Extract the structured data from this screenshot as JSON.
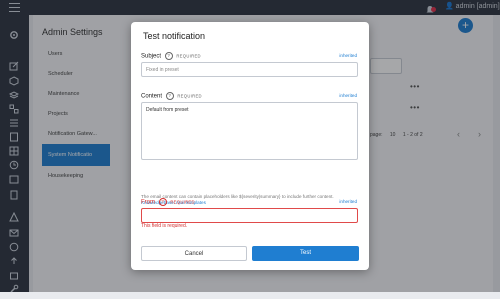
{
  "topbar": {
    "user": "admin [admin]"
  },
  "page": {
    "title": "Admin Settings"
  },
  "nav": [
    {
      "label": "Users"
    },
    {
      "label": "Scheduler"
    },
    {
      "label": "Maintenance"
    },
    {
      "label": "Projects"
    },
    {
      "label": "Notification Gatew..."
    },
    {
      "label": "System Notificatio"
    },
    {
      "label": "Housekeeping"
    }
  ],
  "background": {
    "pager_label": "page:",
    "pager_size": "10",
    "pager_range": "1 - 2 of 2",
    "more": "•••"
  },
  "modal": {
    "title": "Test notification",
    "subject": {
      "label": "Subject",
      "required": "REQUIRED",
      "inherited": "inherited",
      "placeholder": "Fixed in preset"
    },
    "content": {
      "label": "Content",
      "required": "REQUIRED",
      "inherited": "inherited",
      "value": "Default from preset"
    },
    "help": {
      "text": "The email content can contain placeholders like ${severity|summary} to include further content.",
      "link": "Knowledgebase: mail templates"
    },
    "from": {
      "label": "From",
      "required": "REQUIRED",
      "inherited": "inherited",
      "value": "",
      "error": "This field is required."
    },
    "cancel_label": "Cancel",
    "test_label": "Test"
  },
  "colors": {
    "accent": "#1f7ed1",
    "error": "#d43030",
    "sidebar": "#2e3541"
  }
}
